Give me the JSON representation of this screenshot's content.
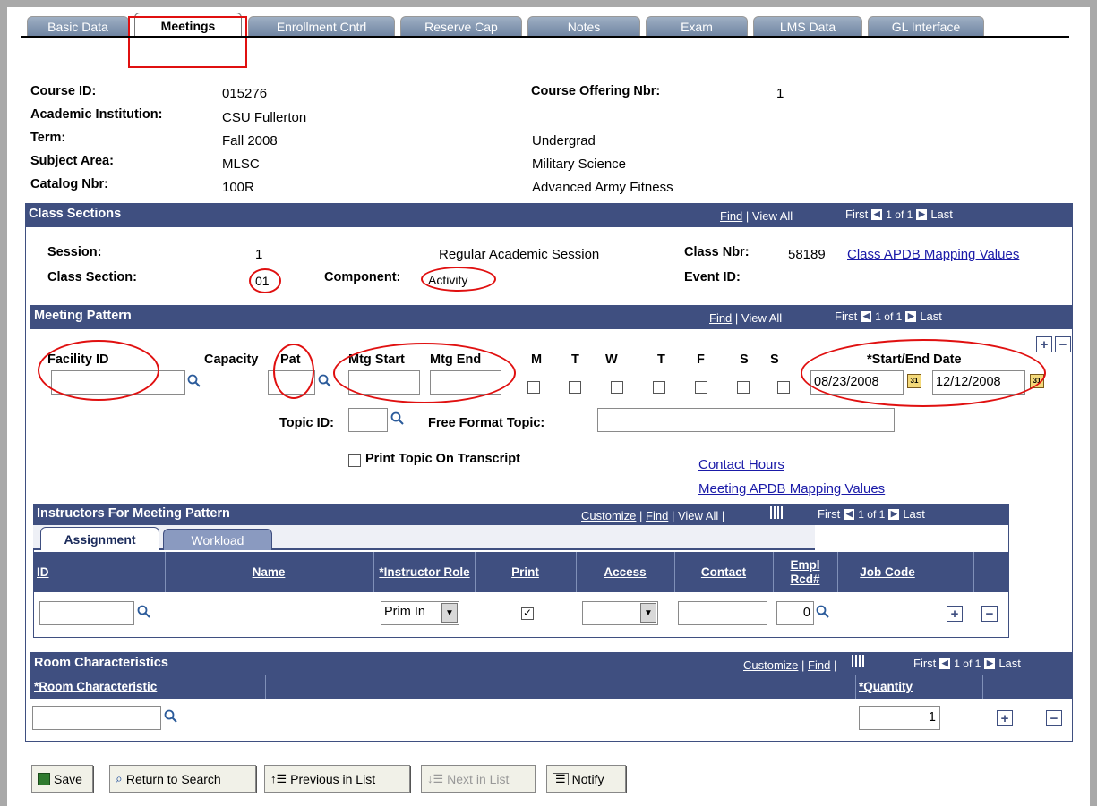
{
  "tabs": [
    {
      "label": "Basic Data"
    },
    {
      "label": "Meetings"
    },
    {
      "label": "Enrollment Cntrl"
    },
    {
      "label": "Reserve Cap"
    },
    {
      "label": "Notes"
    },
    {
      "label": "Exam"
    },
    {
      "label": "LMS Data"
    },
    {
      "label": "GL Interface"
    }
  ],
  "header": {
    "course_id_label": "Course ID:",
    "course_id": "015276",
    "offering_label": "Course Offering Nbr:",
    "offering": "1",
    "institution_label": "Academic Institution:",
    "institution": "CSU Fullerton",
    "term_label": "Term:",
    "term": "Fall 2008",
    "career": "Undergrad",
    "subject_label": "Subject Area:",
    "subject": "MLSC",
    "subject_desc": "Military Science",
    "catalog_label": "Catalog Nbr:",
    "catalog": "100R",
    "catalog_desc": "Advanced Army Fitness"
  },
  "class_sections": {
    "title": "Class Sections",
    "find": "Find",
    "view_all": "View All",
    "first": "First",
    "count": "1 of 1",
    "last": "Last",
    "session_label": "Session:",
    "session": "1",
    "session_desc": "Regular Academic Session",
    "class_nbr_label": "Class Nbr:",
    "class_nbr": "58189",
    "apdb_link": "Class APDB Mapping Values",
    "section_label": "Class Section:",
    "section": "01",
    "component_label": "Component:",
    "component": "Activity",
    "event_label": "Event ID:"
  },
  "meeting_pattern": {
    "title": "Meeting Pattern",
    "find": "Find",
    "view_all": "View All",
    "first": "First",
    "count": "1 of 1",
    "last": "Last",
    "facility_label": "Facility ID",
    "capacity_label": "Capacity",
    "pat_label": "Pat",
    "start_label": "Mtg Start",
    "end_label": "Mtg End",
    "days": [
      "M",
      "T",
      "W",
      "T",
      "F",
      "S",
      "S"
    ],
    "date_label": "*Start/End Date",
    "start_date": "08/23/2008",
    "end_date": "12/12/2008",
    "topic_label": "Topic ID:",
    "free_topic_label": "Free Format Topic:",
    "print_topic_label": "Print Topic On Transcript",
    "contact_link": "Contact Hours",
    "meeting_apdb_link": "Meeting APDB Mapping Values"
  },
  "instructors": {
    "title": "Instructors For Meeting Pattern",
    "customize": "Customize",
    "find": "Find",
    "view_all": "View All",
    "first": "First",
    "count": "1 of 1",
    "last": "Last",
    "subtab_assignment": "Assignment",
    "subtab_workload": "Workload",
    "col_id": "ID",
    "col_name": "Name",
    "col_role": "*Instructor Role",
    "col_print": "Print",
    "col_access": "Access",
    "col_contact": "Contact",
    "col_empl": "Empl Rcd#",
    "col_job": "Job Code",
    "role_value": "Prim In",
    "empl_value": "0"
  },
  "room": {
    "title": "Room Characteristics",
    "customize": "Customize",
    "find": "Find",
    "first": "First",
    "count": "1 of 1",
    "last": "Last",
    "col_char": "*Room Characteristic",
    "col_qty": "*Quantity",
    "qty_value": "1"
  },
  "buttons": {
    "save": "Save",
    "return": "Return to Search",
    "previous": "Previous in List",
    "next": "Next in List",
    "notify": "Notify"
  }
}
